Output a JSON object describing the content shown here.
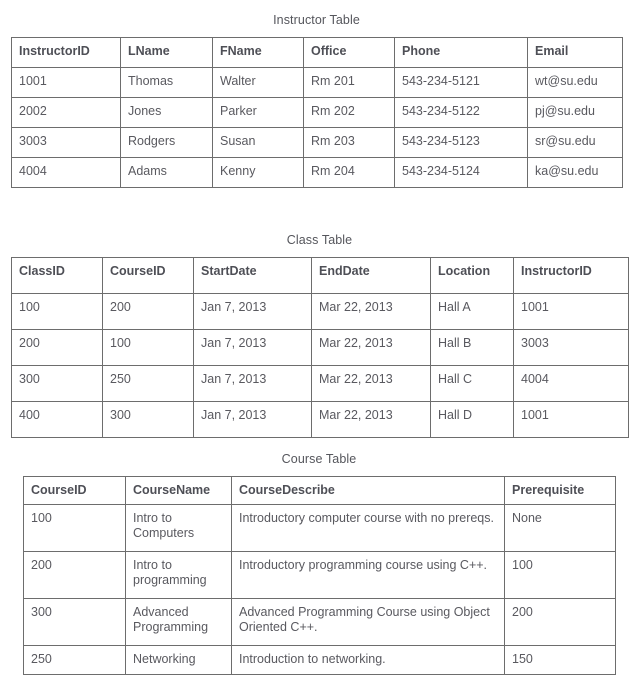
{
  "theme": {
    "background": "#ffffff",
    "text_color": "#59595f",
    "header_text_color": "#4e4f56",
    "border_color": "#6d6d6d",
    "outer_border_color": "#3a3a3a"
  },
  "tables": [
    {
      "id": "instructor",
      "title": "Instructor Table",
      "columns": [
        "InstructorID",
        "LName",
        "FName",
        "Office",
        "Phone",
        "Email"
      ],
      "rows": [
        [
          "1001",
          "Thomas",
          "Walter",
          "Rm 201",
          "543-234-5121",
          "wt@su.edu"
        ],
        [
          "2002",
          "Jones",
          "Parker",
          "Rm 202",
          "543-234-5122",
          "pj@su.edu"
        ],
        [
          "3003",
          "Rodgers",
          "Susan",
          "Rm 203",
          "543-234-5123",
          "sr@su.edu"
        ],
        [
          "4004",
          "Adams",
          "Kenny",
          "Rm 204",
          "543-234-5124",
          "ka@su.edu"
        ]
      ]
    },
    {
      "id": "class",
      "title": "Class Table",
      "columns": [
        "ClassID",
        "CourseID",
        "StartDate",
        "EndDate",
        "Location",
        "InstructorID"
      ],
      "rows": [
        [
          "100",
          "200",
          "Jan 7, 2013",
          "Mar 22, 2013",
          "Hall A",
          "1001"
        ],
        [
          "200",
          "100",
          "Jan 7, 2013",
          "Mar 22, 2013",
          "Hall B",
          "3003"
        ],
        [
          "300",
          "250",
          "Jan 7, 2013",
          "Mar 22, 2013",
          "Hall C",
          "4004"
        ],
        [
          "400",
          "300",
          "Jan 7, 2013",
          "Mar 22, 2013",
          "Hall D",
          "1001"
        ]
      ]
    },
    {
      "id": "course",
      "title": "Course Table",
      "columns": [
        "CourseID",
        "CourseName",
        "CourseDescribe",
        "Prerequisite"
      ],
      "rows": [
        [
          "100",
          "Intro to Computers",
          "Introductory computer course with no prereqs.",
          "None"
        ],
        [
          "200",
          "Intro to programming",
          "Introductory programming course using C++.",
          "100"
        ],
        [
          "300",
          "Advanced Programming",
          "Advanced Programming Course using Object Oriented C++.",
          "200"
        ],
        [
          "250",
          "Networking",
          "Introduction to networking.",
          "150"
        ]
      ],
      "short_rows": [
        3
      ]
    }
  ]
}
